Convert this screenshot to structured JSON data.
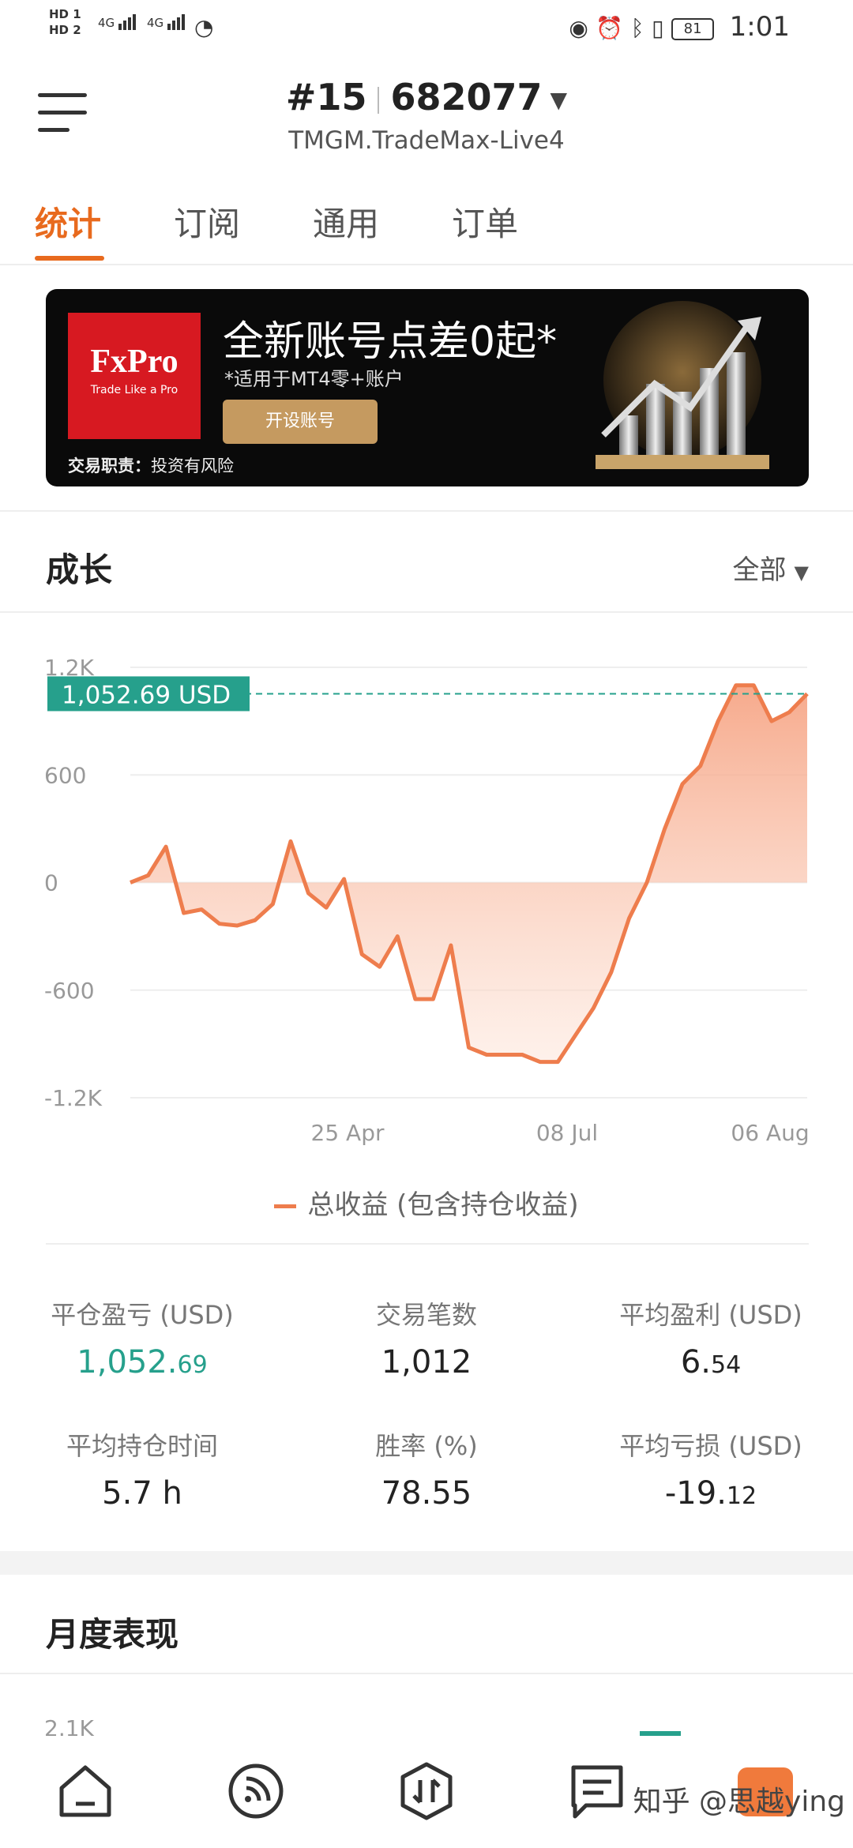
{
  "status_bar": {
    "sim1": "HD 1",
    "sim2": "HD 2",
    "net1": "4G",
    "net2": "4G",
    "battery": "81",
    "time": "1:01"
  },
  "header": {
    "account_number": "#15",
    "account_id": "682077",
    "server": "TMGM.TradeMax-Live4"
  },
  "tabs": [
    {
      "label": "统计",
      "active": true
    },
    {
      "label": "订阅",
      "active": false
    },
    {
      "label": "通用",
      "active": false
    },
    {
      "label": "订单",
      "active": false
    }
  ],
  "banner": {
    "brand": "FxPro",
    "brand_tagline": "Trade Like a Pro",
    "title": "全新账号点差0起*",
    "subtitle": "*适用于MT4零+账户",
    "button": "开设账号",
    "disclaimer_bold": "交易职责：",
    "disclaimer": "投资有风险"
  },
  "growth": {
    "title": "成长",
    "filter": "全部",
    "current_value_label": "1,052.69 USD",
    "legend": "总收益 (包含持仓收益)"
  },
  "chart_data": {
    "type": "area",
    "series": [
      {
        "name": "总收益 (包含持仓收益)",
        "values": [
          0,
          40,
          200,
          -170,
          -150,
          -230,
          -240,
          -210,
          -120,
          230,
          -60,
          -140,
          20,
          -400,
          -470,
          -300,
          -650,
          -650,
          -350,
          -920,
          -960,
          -960,
          -960,
          -1000,
          -1000,
          -850,
          -700,
          -500,
          -200,
          0,
          300,
          550,
          650,
          900,
          1100,
          1100,
          900,
          950,
          1052.69
        ]
      }
    ],
    "y_ticks": [
      "1.2K",
      "600",
      "0",
      "-600",
      "-1.2K"
    ],
    "ylim": [
      -1200,
      1200
    ],
    "x_ticks": [
      "25 Apr",
      "08 Jul",
      "06 Aug"
    ],
    "current_value": 1052.69,
    "grid": true,
    "color": "#ee7d4d"
  },
  "stats": [
    {
      "label": "平仓盈亏 (USD)",
      "int": "1,052.",
      "dec": "69",
      "style": "green"
    },
    {
      "label": "交易笔数",
      "int": "1,012",
      "dec": "",
      "style": "normal"
    },
    {
      "label": "平均盈利 (USD)",
      "int": "6.",
      "dec": "54",
      "style": "normal"
    },
    {
      "label": "平均持仓时间",
      "int": "5.7 h",
      "dec": "",
      "style": "normal"
    },
    {
      "label": "胜率 (%)",
      "int": "78.55",
      "dec": "",
      "style": "normal"
    },
    {
      "label": "平均亏损 (USD)",
      "int": "-19.",
      "dec": "12",
      "style": "normal"
    }
  ],
  "monthly": {
    "title": "月度表现",
    "y_top": "2.1K"
  },
  "bottom_nav": {
    "items": [
      "home-icon",
      "feed-icon",
      "trade-icon",
      "messages-icon",
      "profile-icon"
    ],
    "watermark": "知乎 @思越ying"
  },
  "colors": {
    "accent": "#e86a1e",
    "green": "#26a08c",
    "line": "#ee7d4d"
  }
}
